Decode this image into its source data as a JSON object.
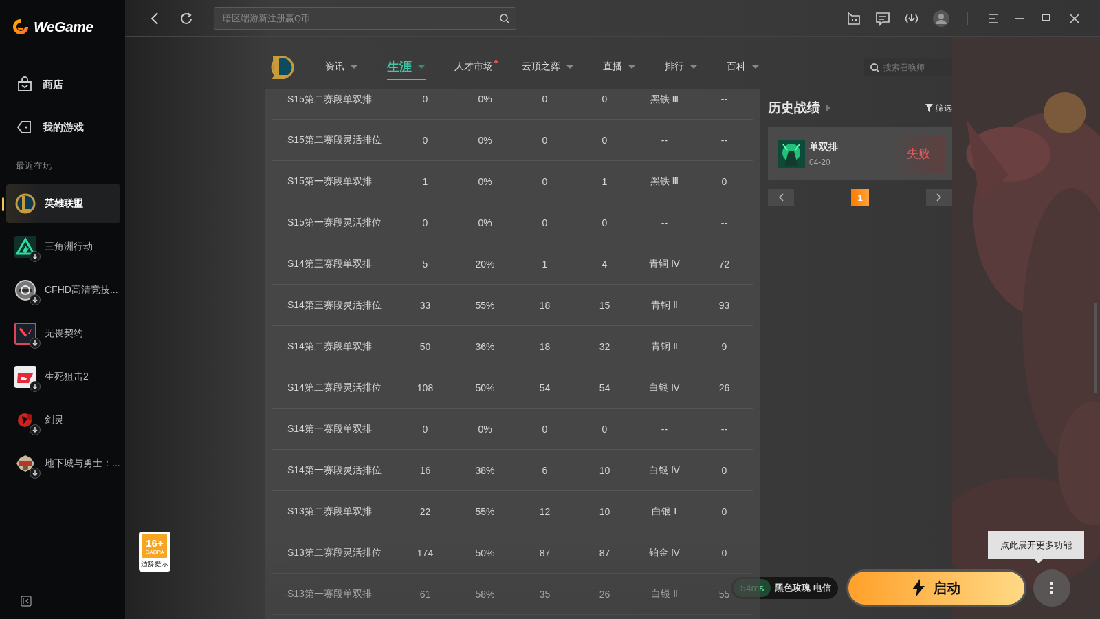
{
  "sidebar": {
    "logo": "WeGame",
    "nav": [
      {
        "label": "商店",
        "kind": "store"
      },
      {
        "label": "我的游戏",
        "kind": "games"
      }
    ],
    "section_label": "最近在玩",
    "games": [
      {
        "name": "英雄联盟",
        "selected": true,
        "needs_download": false
      },
      {
        "name": "三角洲行动",
        "selected": false,
        "needs_download": true
      },
      {
        "name": "CFHD高清竞技...",
        "selected": false,
        "needs_download": true
      },
      {
        "name": "无畏契约",
        "selected": false,
        "needs_download": true
      },
      {
        "name": "生死狙击2",
        "selected": false,
        "needs_download": true
      },
      {
        "name": "剑灵",
        "selected": false,
        "needs_download": true
      },
      {
        "name": "地下城与勇士：...",
        "selected": false,
        "needs_download": true
      }
    ]
  },
  "topbar": {
    "search": {
      "placeholder": "暗区端游新注册赢Q币"
    }
  },
  "game_nav": {
    "tabs": [
      {
        "label": "资讯",
        "selected": false,
        "dropdown": true,
        "dot": false
      },
      {
        "label": "生涯",
        "selected": true,
        "dropdown": true,
        "dot": false
      },
      {
        "label": "人才市场",
        "selected": false,
        "dropdown": false,
        "dot": true
      },
      {
        "label": "云顶之弈",
        "selected": false,
        "dropdown": true,
        "dot": false
      },
      {
        "label": "直播",
        "selected": false,
        "dropdown": true,
        "dot": false
      },
      {
        "label": "排行",
        "selected": false,
        "dropdown": true,
        "dot": false
      },
      {
        "label": "百科",
        "selected": false,
        "dropdown": true,
        "dot": false
      }
    ],
    "search": {
      "placeholder": "搜索召唤师"
    }
  },
  "table": {
    "rows": [
      [
        "S15第二赛段单双排",
        "0",
        "0%",
        "0",
        "0",
        "黑铁 Ⅲ",
        "--"
      ],
      [
        "S15第二赛段灵活排位",
        "0",
        "0%",
        "0",
        "0",
        "--",
        "--"
      ],
      [
        "S15第一赛段单双排",
        "1",
        "0%",
        "0",
        "1",
        "黑铁 Ⅲ",
        "0"
      ],
      [
        "S15第一赛段灵活排位",
        "0",
        "0%",
        "0",
        "0",
        "--",
        "--"
      ],
      [
        "S14第三赛段单双排",
        "5",
        "20%",
        "1",
        "4",
        "青铜 Ⅳ",
        "72"
      ],
      [
        "S14第三赛段灵活排位",
        "33",
        "55%",
        "18",
        "15",
        "青铜 Ⅱ",
        "93"
      ],
      [
        "S14第二赛段单双排",
        "50",
        "36%",
        "18",
        "32",
        "青铜 Ⅱ",
        "9"
      ],
      [
        "S14第二赛段灵活排位",
        "108",
        "50%",
        "54",
        "54",
        "白银 Ⅳ",
        "26"
      ],
      [
        "S14第一赛段单双排",
        "0",
        "0%",
        "0",
        "0",
        "--",
        "--"
      ],
      [
        "S14第一赛段灵活排位",
        "16",
        "38%",
        "6",
        "10",
        "白银 Ⅳ",
        "0"
      ],
      [
        "S13第二赛段单双排",
        "22",
        "55%",
        "12",
        "10",
        "白银 Ⅰ",
        "0"
      ],
      [
        "S13第二赛段灵活排位",
        "174",
        "50%",
        "87",
        "87",
        "铂金 Ⅳ",
        "0"
      ],
      [
        "S13第一赛段单双排",
        "61",
        "58%",
        "35",
        "26",
        "白银 Ⅱ",
        "55"
      ]
    ]
  },
  "history": {
    "title": "历史战绩",
    "filter": "筛选",
    "matches": [
      {
        "mode": "单双排",
        "date": "04-20",
        "result": "失败",
        "won": false
      }
    ],
    "pages": [
      {
        "label": "1",
        "selected": true
      }
    ]
  },
  "age_rating": {
    "age": "16+",
    "org": "CADPA",
    "caption": "适龄提示"
  },
  "launch": {
    "ping": "54ms",
    "server": "黑色玫瑰 电信",
    "button": "启动",
    "tooltip": "点此展开更多功能"
  }
}
